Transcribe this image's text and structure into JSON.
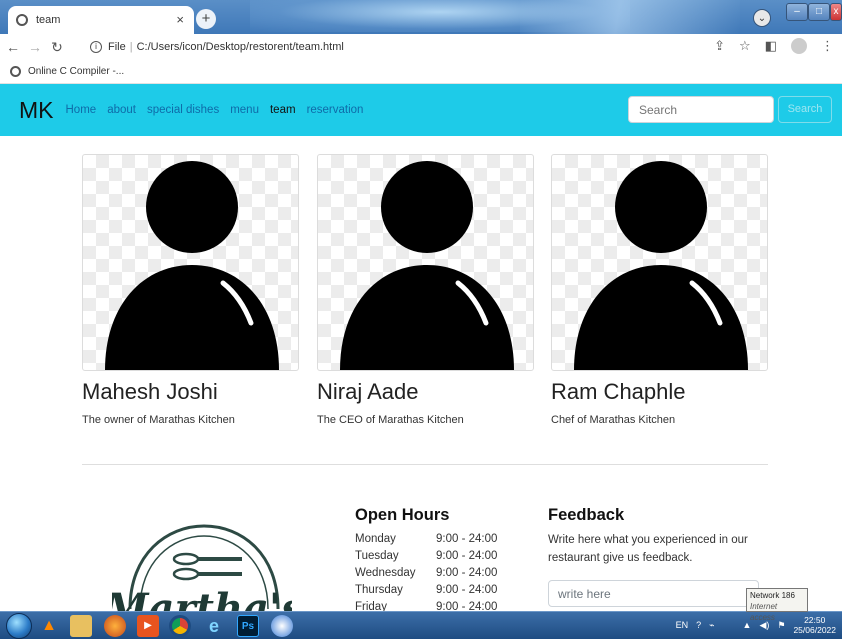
{
  "browser": {
    "tab_title": "team",
    "tab_close": "×",
    "new_tab": "+",
    "url_prefix": "File",
    "url": "C:/Users/icon/Desktop/restorent/team.html",
    "bookmark": "Online C Compiler -..."
  },
  "nav": {
    "brand": "MK",
    "links": [
      "Home",
      "about",
      "special dishes",
      "menu",
      "team",
      "reservation"
    ],
    "active": "team",
    "search_placeholder": "Search",
    "search_button": "Search"
  },
  "team": [
    {
      "name": "Mahesh Joshi",
      "role": "The owner of Marathas Kitchen"
    },
    {
      "name": "Niraj Aade",
      "role": "The CEO of Marathas Kitchen"
    },
    {
      "name": "Ram Chaphle",
      "role": "Chef of Marathas Kitchen"
    }
  ],
  "footer": {
    "logo_text": "Martha's",
    "hours_title": "Open Hours",
    "hours": [
      {
        "day": "Monday",
        "time": "9:00 - 24:00"
      },
      {
        "day": "Tuesday",
        "time": "9:00 - 24:00"
      },
      {
        "day": "Wednesday",
        "time": "9:00 - 24:00"
      },
      {
        "day": "Thursday",
        "time": "9:00 - 24:00"
      },
      {
        "day": "Friday",
        "time": "9:00 - 24:00"
      }
    ],
    "feedback_title": "Feedback",
    "feedback_text": "Write here what you experienced in our restaurant give us feedback.",
    "feedback_placeholder": "write here"
  },
  "tooltip": {
    "line1": "Network 186",
    "line2": "Internet access"
  },
  "taskbar": {
    "lang": "EN",
    "time": "22:50",
    "date": "25/06/2022",
    "ps_label": "Ps"
  },
  "colors": {
    "navbar": "#1ecbe8",
    "link": "#0f6ba8"
  }
}
